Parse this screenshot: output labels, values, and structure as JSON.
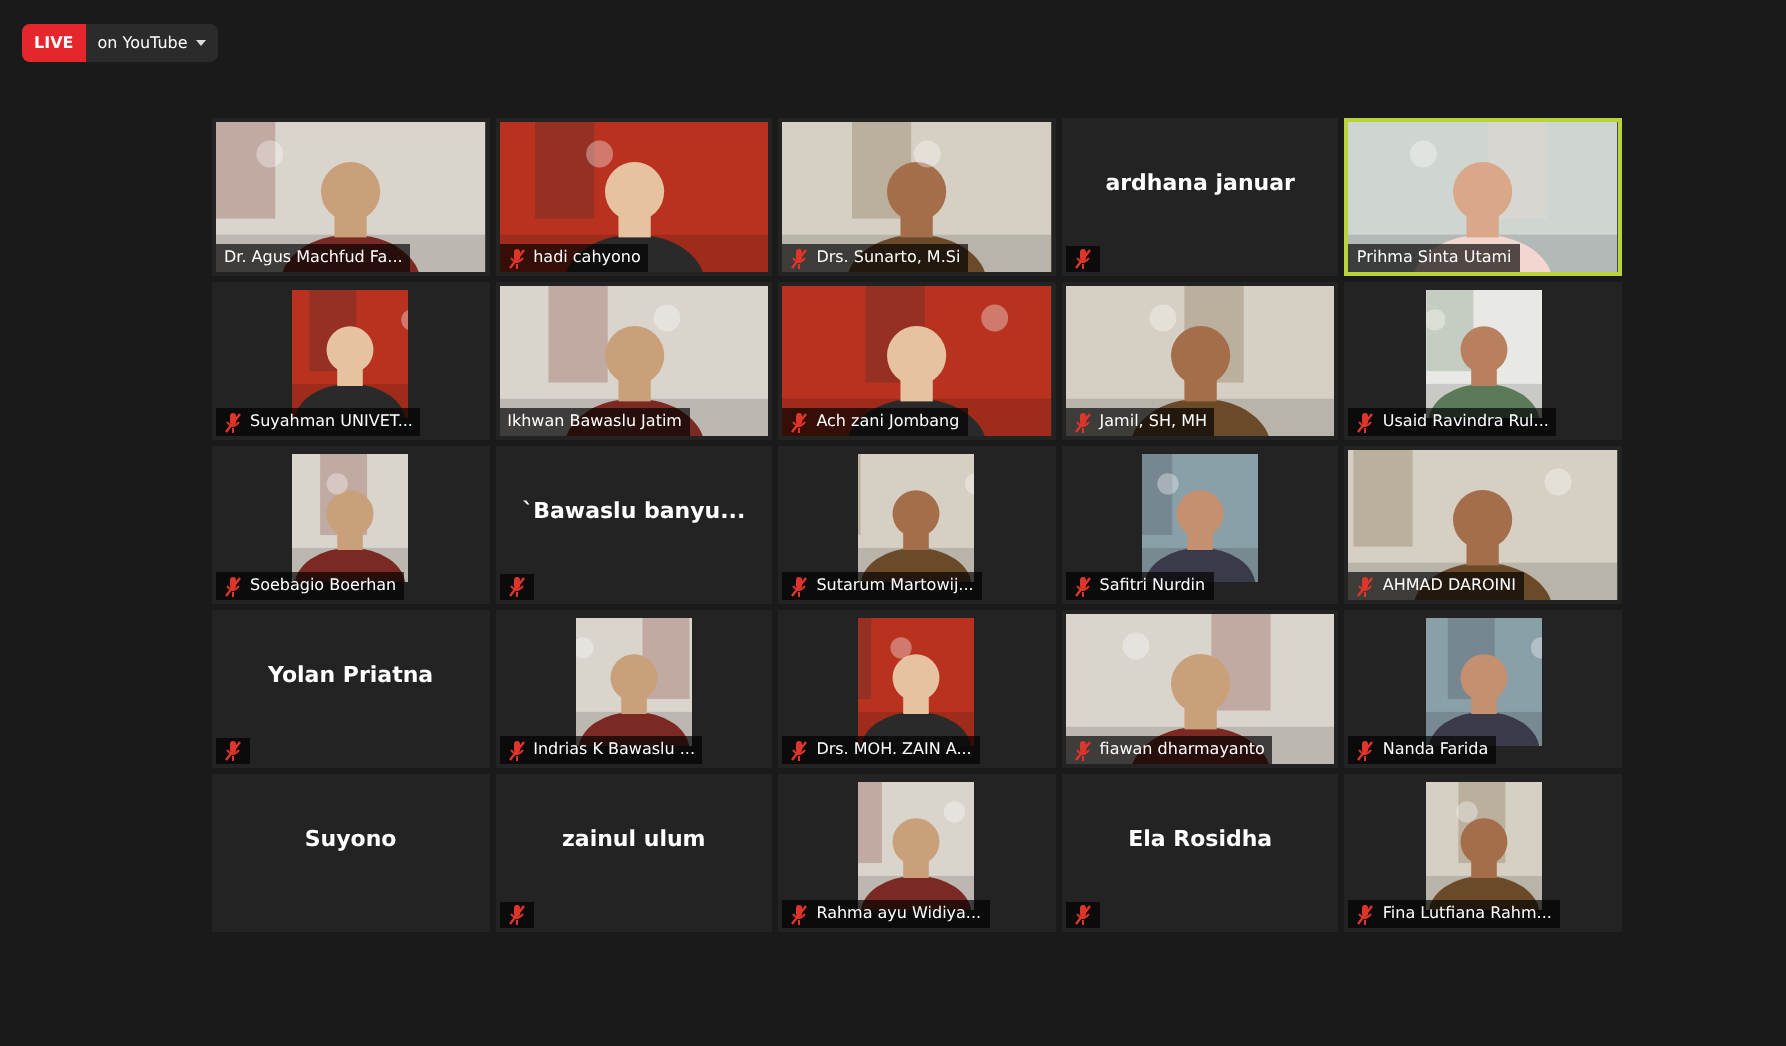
{
  "stream": {
    "badge": "LIVE",
    "platform": "on YouTube"
  },
  "participants": [
    {
      "name": "Dr. Agus Machfud Fa...",
      "kind": "video",
      "muted": false,
      "speaking": false
    },
    {
      "name": "hadi cahyono",
      "kind": "video",
      "muted": true,
      "speaking": false
    },
    {
      "name": "Drs. Sunarto, M.Si",
      "kind": "video",
      "muted": true,
      "speaking": false
    },
    {
      "name": "ardhana januar",
      "kind": "name",
      "muted": true,
      "speaking": false
    },
    {
      "name": "Prihma Sinta Utami",
      "kind": "video",
      "muted": false,
      "speaking": true
    },
    {
      "name": "Suyahman UNIVET...",
      "muted": true,
      "speaking": false
    },
    {
      "name": "Ikhwan Bawaslu Jatim",
      "kind": "video",
      "muted": false,
      "speaking": false
    },
    {
      "name": "Ach zani Jombang",
      "kind": "video",
      "muted": true,
      "speaking": false
    },
    {
      "name": "Jamil, SH, MH",
      "kind": "video",
      "muted": true,
      "speaking": false
    },
    {
      "name": "Usaid Ravindra Rul...",
      "muted": true,
      "speaking": false
    },
    {
      "name": "Soebagio Boerhan",
      "muted": true,
      "speaking": false
    },
    {
      "name": "`Bawaslu  banyu...",
      "kind": "name",
      "muted": true,
      "speaking": false
    },
    {
      "name": "Sutarum Martowij...",
      "muted": true,
      "speaking": false
    },
    {
      "name": "Safitri Nurdin",
      "muted": true,
      "speaking": false
    },
    {
      "name": "AHMAD DAROINI",
      "kind": "video",
      "muted": true,
      "speaking": false
    },
    {
      "name": "Yolan Priatna",
      "kind": "name",
      "muted": true,
      "speaking": false
    },
    {
      "name": "Indrias K Bawaslu ...",
      "muted": true,
      "speaking": false
    },
    {
      "name": "Drs. MOH. ZAIN A...",
      "muted": true,
      "speaking": false
    },
    {
      "name": "fiawan dharmayanto",
      "kind": "video",
      "muted": true,
      "speaking": false
    },
    {
      "name": "Nanda Farida",
      "muted": true,
      "speaking": false
    },
    {
      "name": "Suyono",
      "kind": "name",
      "muted": false,
      "speaking": false
    },
    {
      "name": "zainul ulum",
      "kind": "name",
      "muted": true,
      "speaking": false
    },
    {
      "name": "Rahma ayu Widiya...",
      "muted": true,
      "speaking": false
    },
    {
      "name": "Ela Rosidha",
      "kind": "name",
      "muted": true,
      "speaking": false
    },
    {
      "name": "Fina Lutfiana Rahm...",
      "muted": true,
      "speaking": false
    }
  ]
}
